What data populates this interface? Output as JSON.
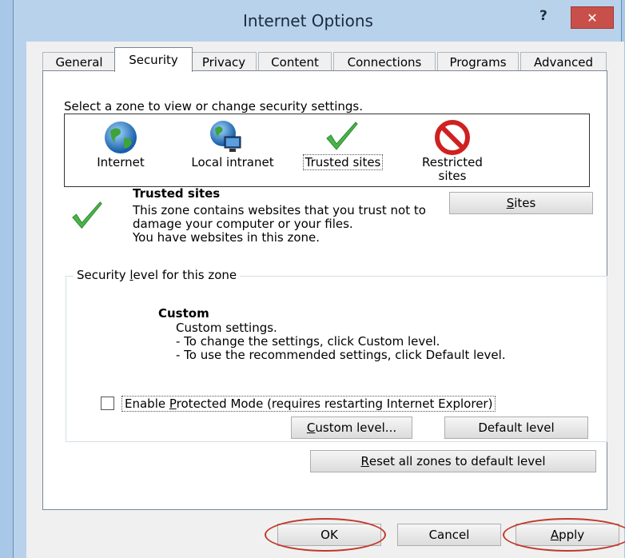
{
  "window": {
    "title": "Internet Options",
    "help_label": "?",
    "close_label": "✕"
  },
  "tabs": [
    {
      "label": "General"
    },
    {
      "label": "Security",
      "active": true
    },
    {
      "label": "Privacy"
    },
    {
      "label": "Content"
    },
    {
      "label": "Connections"
    },
    {
      "label": "Programs"
    },
    {
      "label": "Advanced"
    }
  ],
  "security": {
    "zone_prompt": "Select a zone to view or change security settings.",
    "zones": [
      {
        "label": "Internet",
        "icon": "globe-icon"
      },
      {
        "label": "Local intranet",
        "icon": "intranet-globe-icon"
      },
      {
        "label": "Trusted sites",
        "icon": "checkmark-icon",
        "selected": true
      },
      {
        "label": "Restricted sites",
        "label_line1": "Restricted",
        "label_line2": "sites",
        "icon": "no-entry-icon"
      }
    ],
    "selected_zone": {
      "heading": "Trusted sites",
      "description": "This zone contains websites that you trust not to damage your computer or your files.",
      "note": "You have websites in this zone."
    },
    "sites_button": {
      "prefix": "",
      "mnemonic": "S",
      "rest": "ites"
    },
    "level_group_title": {
      "prefix": "Security ",
      "mnemonic": "l",
      "rest": "evel for this zone"
    },
    "level": {
      "name": "Custom",
      "desc_line1": "Custom settings.",
      "desc_line2": "- To change the settings, click Custom level.",
      "desc_line3": "- To use the recommended settings, click Default level."
    },
    "protected_mode": {
      "checked": false,
      "label_prefix": "Enable ",
      "label_mnemonic": "P",
      "label_rest": "rotected Mode (requires restarting Internet Explorer)"
    },
    "custom_level_button": {
      "mnemonic": "C",
      "rest": "ustom level..."
    },
    "default_level_button": {
      "label": "Default level"
    },
    "reset_button": {
      "mnemonic": "R",
      "rest": "eset all zones to default level"
    }
  },
  "footer": {
    "ok_label": "OK",
    "cancel_label": "Cancel",
    "apply_mnemonic": "A",
    "apply_rest": "pply"
  },
  "colors": {
    "highlight_ellipse": "#c0392b",
    "titlebar": "#b8d2ec",
    "close_button": "#c9504a"
  }
}
